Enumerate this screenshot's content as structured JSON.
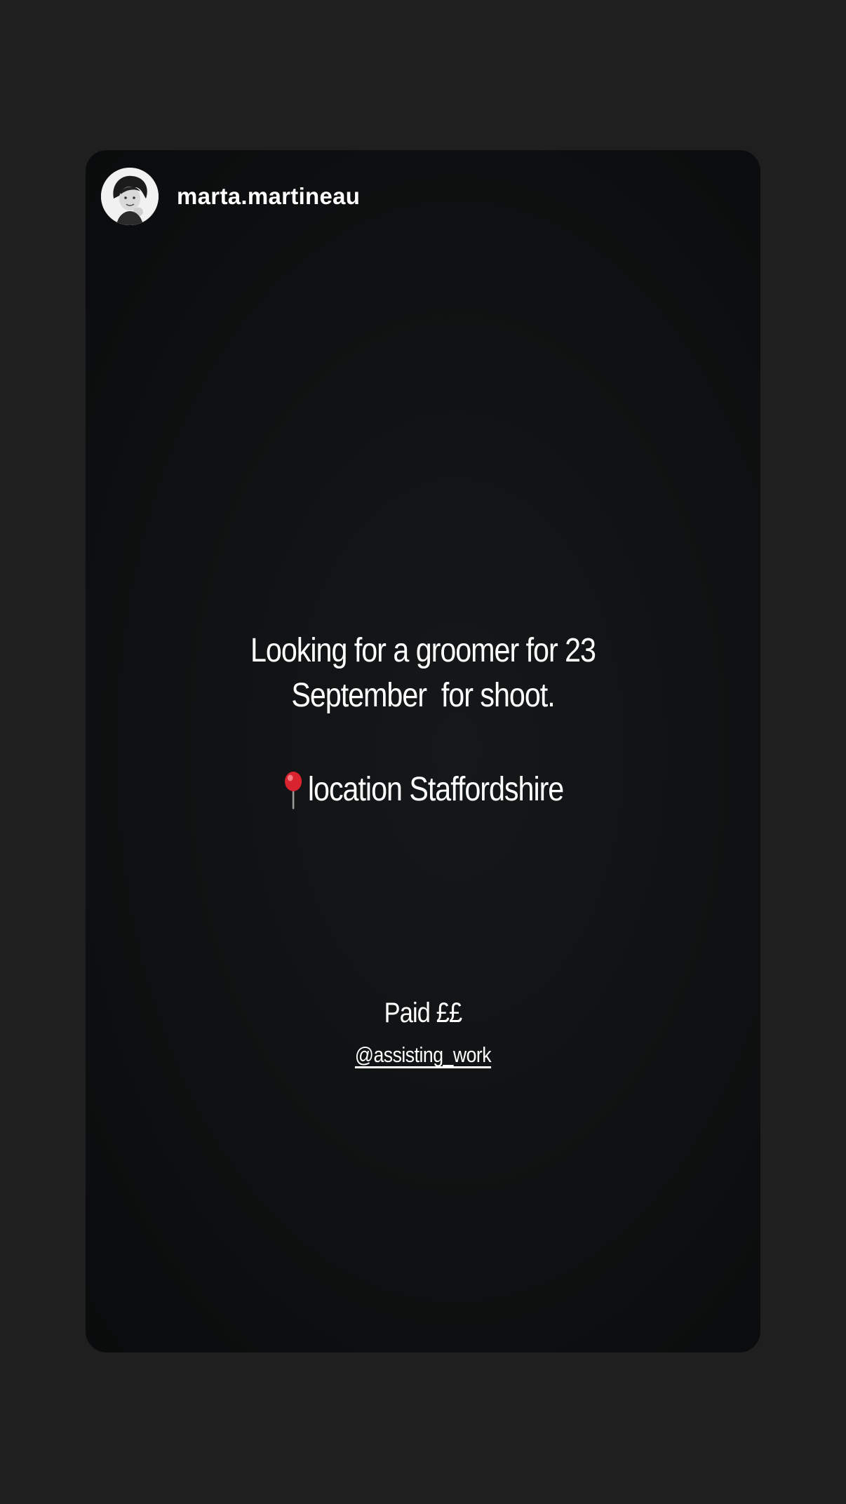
{
  "story": {
    "username": "marta.martineau",
    "headline_line1": "Looking for a groomer for 23",
    "headline_line2": "September  for shoot.",
    "location_icon": "round-pushpin-icon",
    "location_text": "location Staffordshire",
    "paid_text": "Paid ££",
    "mention": "@assisting_work"
  },
  "colors": {
    "outer_background": "#1f1f1f",
    "card_background": "#0f1112",
    "text": "#ffffff",
    "pin_red": "#d9232e"
  }
}
